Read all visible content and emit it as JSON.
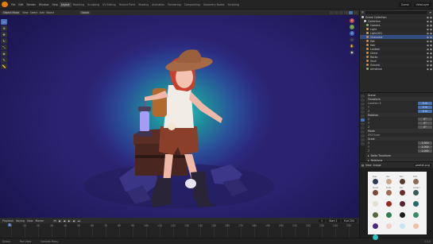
{
  "menu": {
    "items": [
      "File",
      "Edit",
      "Render",
      "Window",
      "Help"
    ],
    "workspaces": [
      "Layout",
      "Modeling",
      "Sculpting",
      "UV Editing",
      "Texture Paint",
      "Shading",
      "Animation",
      "Rendering",
      "Compositing",
      "Geometry Nodes",
      "Scripting"
    ],
    "active_workspace": "Layout",
    "scene": "Scene",
    "view_layer": "ViewLayer"
  },
  "viewport": {
    "mode": "Object Mode",
    "menus": [
      "View",
      "Select",
      "Add",
      "Object"
    ],
    "orientation": "Global",
    "tools": [
      "cursor-icon",
      "move-icon",
      "rotate-icon",
      "scale-icon",
      "transform-icon",
      "annotate-icon",
      "measure-icon"
    ],
    "gizmo": [
      "X",
      "Y",
      "Z"
    ],
    "colors": {
      "glow": "#27c7c2",
      "background": "#2c2b7f"
    }
  },
  "timeline": {
    "menus": [
      "Playback",
      "Keying",
      "View",
      "Marker"
    ],
    "start_label": "Start",
    "start": "1",
    "end_label": "End",
    "end": "250",
    "current_frame": "1",
    "ticks": [
      "0",
      "10",
      "20",
      "30",
      "40",
      "50",
      "60",
      "70",
      "80",
      "90",
      "100",
      "110",
      "120",
      "130",
      "140",
      "150",
      "160",
      "170",
      "180",
      "190",
      "200",
      "210",
      "220",
      "230",
      "240",
      "250"
    ]
  },
  "outliner": {
    "rows": [
      {
        "label": "Scene Collection",
        "color": "#c8c8c8"
      },
      {
        "label": "Collection",
        "color": "#c8c8c8"
      },
      {
        "label": "Camera",
        "color": "#8fb56c"
      },
      {
        "label": "Light",
        "color": "#d8a35a"
      },
      {
        "label": "Light.001",
        "color": "#d8a35a"
      },
      {
        "label": "Character",
        "color": "#e58a3c"
      },
      {
        "label": "Hat",
        "color": "#e58a3c"
      },
      {
        "label": "Hair",
        "color": "#e58a3c"
      },
      {
        "label": "Lantern",
        "color": "#e58a3c"
      },
      {
        "label": "Chest",
        "color": "#e58a3c"
      },
      {
        "label": "Rocks",
        "color": "#e58a3c"
      },
      {
        "label": "Skull",
        "color": "#e58a3c"
      },
      {
        "label": "Ground",
        "color": "#e58a3c"
      },
      {
        "label": "Armature",
        "color": "#8fb56c"
      }
    ],
    "selected_index": 5
  },
  "properties": {
    "header": "Scene",
    "sections": [
      {
        "title": "Transform",
        "rows": [
          [
            "Location X",
            "0 m"
          ],
          [
            "Y",
            "0 m"
          ],
          [
            "Z",
            "0 m"
          ]
        ]
      },
      {
        "title": "Rotation",
        "rows": [
          [
            "X",
            "0°"
          ],
          [
            "Y",
            "0°"
          ],
          [
            "Z",
            "0°"
          ]
        ]
      },
      {
        "title": "Mode",
        "rows": [
          [
            "XYZ Euler",
            ""
          ]
        ]
      },
      {
        "title": "Scale",
        "rows": [
          [
            "X",
            "1.000"
          ],
          [
            "Y",
            "1.000"
          ],
          [
            "Z",
            "1.000"
          ]
        ]
      }
    ],
    "panels": [
      "Delta Transform",
      "Relations",
      "Collections",
      "Instancing",
      "Motion Paths",
      "Visibility",
      "Viewport Display",
      "Line Art",
      "Custom Properties"
    ]
  },
  "image_editor": {
    "menus": [
      "View",
      "Image"
    ],
    "filename": "palette.png",
    "swatch_labels": [
      "Eyes",
      "Hair",
      "Skin",
      "Shirt",
      "Shorts",
      "Boots",
      "Hat",
      "Lantern"
    ],
    "swatches": [
      "#2b3a55",
      "#caa58a",
      "#5b3b2d",
      "#8a6a55",
      "#7a4a34",
      "#a06b50",
      "#6a2a2a",
      "#3a5a5a",
      "#e4ddd3",
      "#a02626",
      "#5b2230",
      "#2a6a6a",
      "#556b3a",
      "#2e7d4f",
      "#1c1c1c",
      "#3a8a6a",
      "#4a2a7a",
      "#f0d0c8",
      "#c8e8f0",
      "#f0c0a8",
      "#2ac0c0"
    ]
  },
  "status": {
    "left": "Select",
    "mid": "Pan View",
    "right": "Context Menu",
    "version": "3.0.0"
  }
}
